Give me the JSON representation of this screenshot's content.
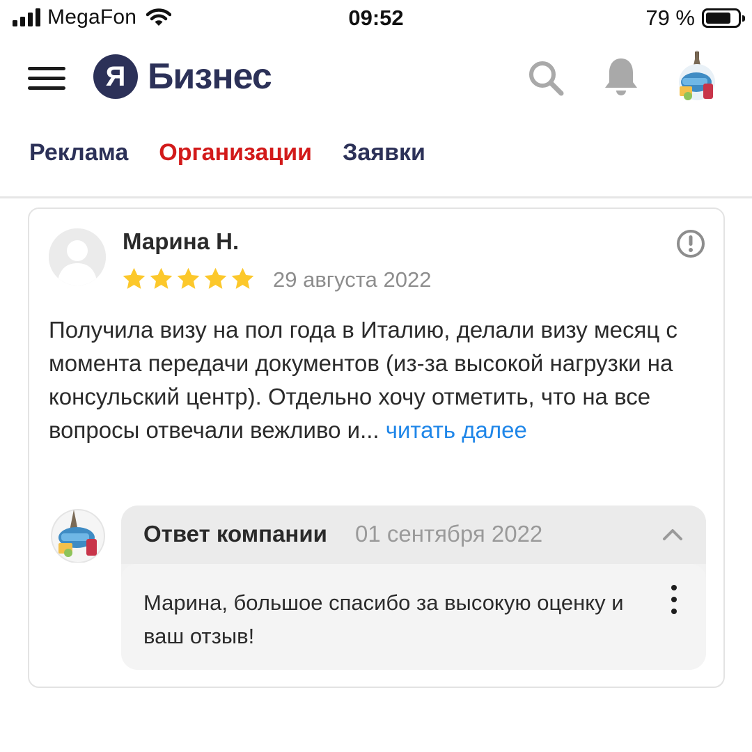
{
  "status_bar": {
    "carrier": "MegaFon",
    "time": "09:52",
    "battery_text": "79 %",
    "battery_level": 0.79,
    "icons": [
      "signal-icon",
      "wifi-icon",
      "battery-icon"
    ]
  },
  "header": {
    "logo_letter": "Я",
    "logo_text": "Бизнес",
    "icons": [
      "menu-icon",
      "search-icon",
      "bell-icon",
      "avatar"
    ]
  },
  "tabs": [
    {
      "label": "Реклама",
      "active": false
    },
    {
      "label": "Организации",
      "active": true
    },
    {
      "label": "Заявки",
      "active": false
    }
  ],
  "review": {
    "author": "Марина Н.",
    "rating": 5,
    "max_rating": 5,
    "date": "29 августа 2022",
    "text": "Получила визу на пол года в Италию, делали визу месяц с момента передачи документов (из-за высокой нагрузки на консульский центр). Отдельно хочу отметить, что на все вопросы отвечали вежливо и...",
    "read_more": "читать далее"
  },
  "answer": {
    "title": "Ответ компании",
    "date": "01 сентября 2022",
    "text": "Марина, большое спасибо за высокую оценку и ваш отзыв!"
  },
  "colors": {
    "brand": "#2c3158",
    "active_tab": "#d21a1a",
    "link": "#1f86e8",
    "star": "#fcc82b"
  }
}
